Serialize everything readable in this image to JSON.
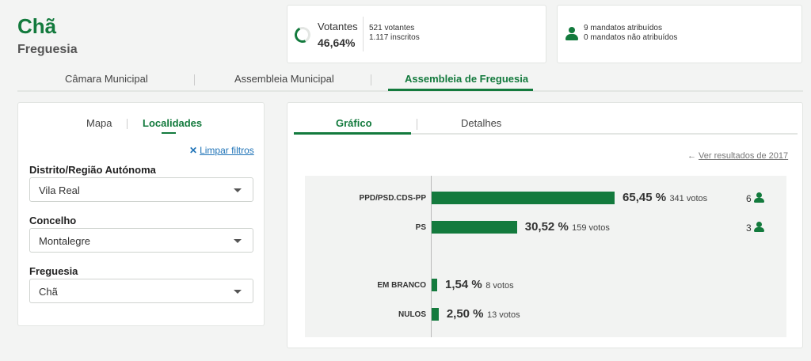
{
  "header": {
    "title": "Chã",
    "subtitle": "Freguesia"
  },
  "turnout": {
    "label": "Votantes",
    "percent": "46,64%",
    "percent_value": 46.64,
    "voters": "521 votantes",
    "registered": "1.117 inscritos"
  },
  "mandates": {
    "assigned": "9 mandatos atribuídos",
    "unassigned": "0 mandatos não atribuídos"
  },
  "main_tabs": [
    {
      "label": "Câmara Municipal"
    },
    {
      "label": "Assembleia Municipal"
    },
    {
      "label": "Assembleia de Freguesia",
      "active": true
    }
  ],
  "filters": {
    "tabs": [
      {
        "label": "Mapa"
      },
      {
        "label": "Localidades",
        "active": true
      }
    ],
    "clear_label": "Limpar filtros",
    "fields": [
      {
        "label": "Distrito/Região Autónoma",
        "value": "Vila Real"
      },
      {
        "label": "Concelho",
        "value": "Montalegre"
      },
      {
        "label": "Freguesia",
        "value": "Chã"
      }
    ]
  },
  "results": {
    "tabs": [
      {
        "label": "Gráfico",
        "active": true
      },
      {
        "label": "Detalhes"
      }
    ],
    "previous_link": "Ver resultados de 2017"
  },
  "colors": {
    "accent": "#137a3d",
    "link": "#1f73b7"
  },
  "chart_data": {
    "type": "bar",
    "orientation": "horizontal",
    "categories": [
      "PPD/PSD.CDS-PP",
      "PS",
      "EM BRANCO",
      "NULOS"
    ],
    "values": [
      65.45,
      30.52,
      1.54,
      2.5
    ],
    "percent_labels": [
      "65,45 %",
      "30,52 %",
      "1,54 %",
      "2,50 %"
    ],
    "votes_labels": [
      "341 votos",
      "159 votos",
      "8 votos",
      "13 votos"
    ],
    "seats": [
      "6",
      "3",
      null,
      null
    ]
  }
}
